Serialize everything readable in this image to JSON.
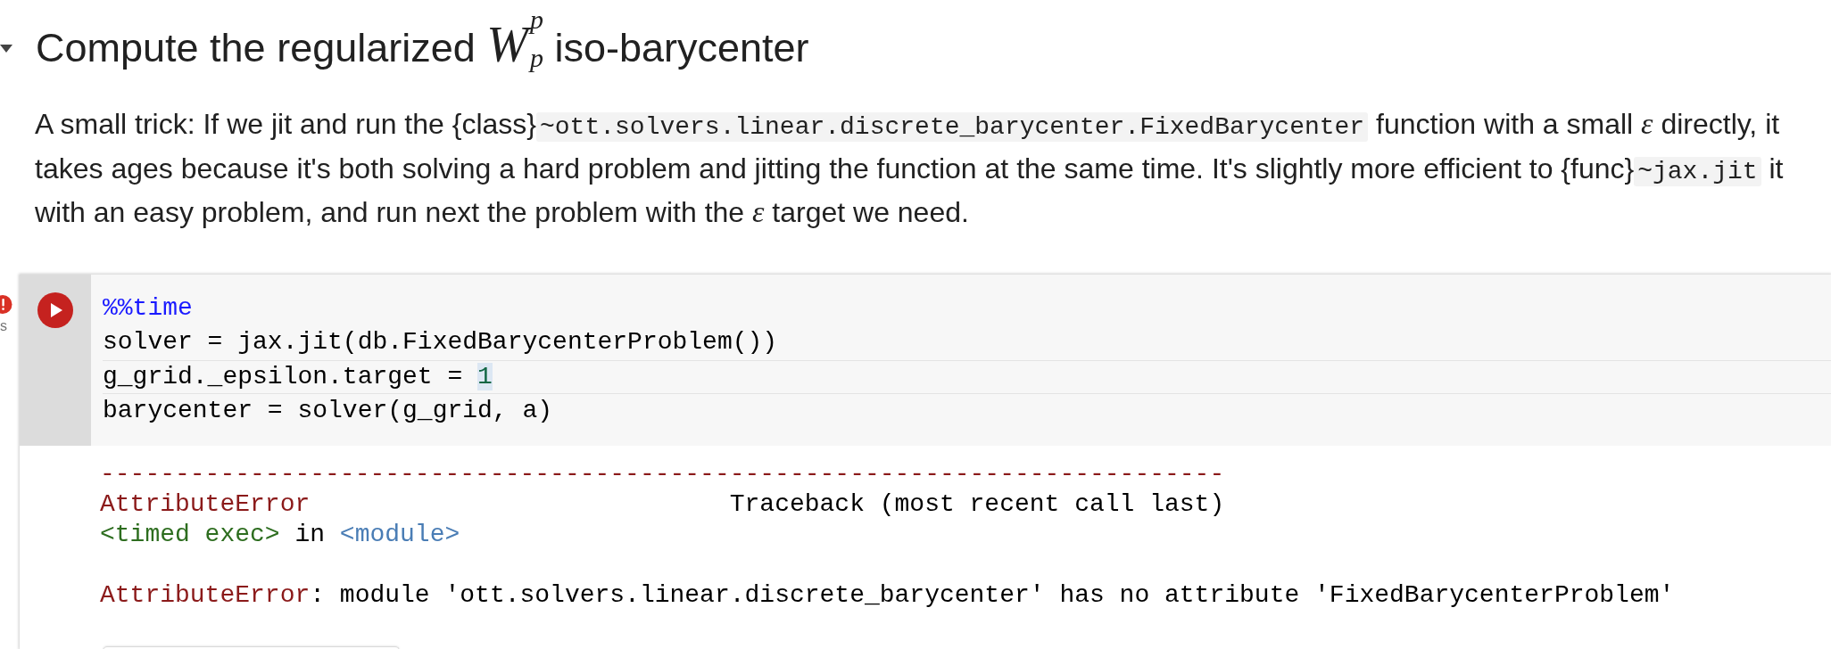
{
  "section": {
    "expanded": true,
    "title": [
      {
        "kind": "text",
        "text": "Compute the regularized "
      },
      {
        "kind": "math",
        "base": "W",
        "sub": "p",
        "sup": "p"
      },
      {
        "kind": "text",
        "text": " iso-barycenter"
      }
    ]
  },
  "paragraph": [
    {
      "kind": "text",
      "text": "A small trick: If we jit and run the {class}"
    },
    {
      "kind": "code",
      "text": "~ott.solvers.linear.discrete_barycenter.FixedBarycenter"
    },
    {
      "kind": "text",
      "text": " function with a small "
    },
    {
      "kind": "math",
      "text": "ε"
    },
    {
      "kind": "text",
      "text": " directly, it takes ages because it's both solving a hard problem and jitting the function at the same time. It's slightly more efficient to {func}"
    },
    {
      "kind": "code",
      "text": "~jax.jit"
    },
    {
      "kind": "text",
      "text": " it with an easy problem, and run next the problem with the "
    },
    {
      "kind": "math",
      "text": "ε"
    },
    {
      "kind": "text",
      "text": " target we need."
    }
  ],
  "code_cell": {
    "failed": true,
    "exec_time": "s",
    "lines": [
      {
        "current": false,
        "tokens": [
          {
            "kind": "magic",
            "text": "%%time",
            "highlighted": false
          }
        ]
      },
      {
        "current": false,
        "tokens": [
          {
            "kind": "plain",
            "text": "solver = jax.jit(db.FixedBarycenterProblem())",
            "highlighted": false
          }
        ]
      },
      {
        "current": true,
        "tokens": [
          {
            "kind": "plain",
            "text": "g_grid._epsilon.target = ",
            "highlighted": false
          },
          {
            "kind": "number",
            "text": "1",
            "highlighted": true
          }
        ]
      },
      {
        "current": false,
        "tokens": [
          {
            "kind": "plain",
            "text": "barycenter = solver(g_grid, a)",
            "highlighted": false
          }
        ]
      }
    ],
    "output": [
      {
        "kind": "rule",
        "parts": [
          {
            "kind": "error",
            "text": "---------------------------------------------------------------------------"
          }
        ]
      },
      {
        "kind": "header",
        "parts": [
          {
            "kind": "error",
            "text": "AttributeError"
          },
          {
            "kind": "plain",
            "text": "                            Traceback (most recent call last)"
          }
        ]
      },
      {
        "kind": "location",
        "parts": [
          {
            "kind": "file",
            "text": "<timed exec>"
          },
          {
            "kind": "plain",
            "text": " in "
          },
          {
            "kind": "scope",
            "text": "<module>"
          }
        ]
      },
      {
        "kind": "message",
        "parts": [
          {
            "kind": "error",
            "text": "AttributeError"
          },
          {
            "kind": "plain",
            "text": ": module 'ott.solvers.linear.discrete_barycenter' has no attribute 'FixedBarycenterProblem'"
          }
        ]
      }
    ]
  }
}
